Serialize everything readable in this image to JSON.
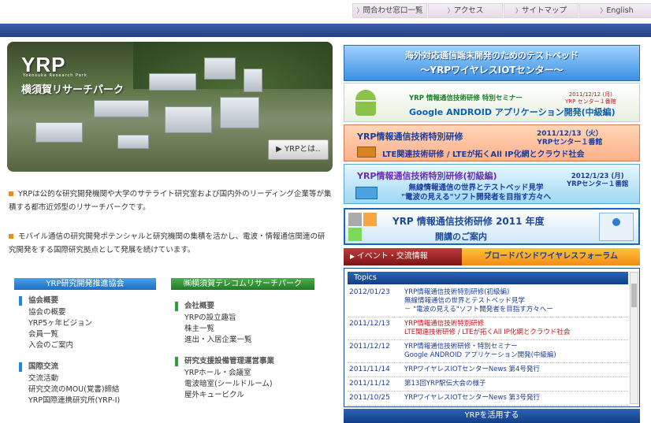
{
  "topnav": {
    "links": [
      "問合わせ窓口一覧",
      "アクセス",
      "サイトマップ",
      "English"
    ]
  },
  "hero": {
    "logo": "YRP",
    "logo_sub": "Yokosuka Research Park",
    "tagline": "横須賀リサーチパーク",
    "about_button": "▶ YRPとは‥"
  },
  "intro": {
    "p1": "YRPは公的な研究開発機関や大学のサテライト研究室および国内外のリーディング企業等が集積する都市近郊型のリサーチパークです。",
    "p2": "モバイル通信の研究開発ポテンシャルと研究機関の集積を活かし、電波・情報通信関連の研究開発をする国際研究拠点として発展を続けています。"
  },
  "left_section": {
    "header": "YRP研究開発推進協会",
    "groups": [
      {
        "heading": "協会概要",
        "items": [
          "協会の概要",
          "YRP5ヶ年ビジョン",
          "会員一覧",
          "入会のご案内"
        ]
      },
      {
        "heading": "国際交流",
        "items": [
          "交流活動",
          "研究交流のMOU(覚書)締結",
          "YRP国際連携研究所(YRP-I)"
        ]
      }
    ]
  },
  "right_section": {
    "header": "㈱横須賀テレコムリサーチパーク",
    "groups": [
      {
        "heading": "会社概要",
        "items": [
          "YRPの設立趣旨",
          "株主一覧",
          "進出・入居企業一覧"
        ]
      },
      {
        "heading": "研究支援設備管理運営事業",
        "items": [
          "YRPホール・会議室",
          "電波暗室(シールドルーム)",
          "屋外キュービクル"
        ]
      }
    ]
  },
  "banners": {
    "b1": {
      "line1": "海外対応通信端末開発のためのテストベッド",
      "line2": "〜YRPワイヤレスIOTセンター〜"
    },
    "b2": {
      "line1": "YRP 情報通信技術研修  特別セミナー",
      "line2": "Google ANDROID アプリケーション開発(中級編)",
      "date1": "2011/12/12 (月)",
      "date2": "YRP センター１番館"
    },
    "b3": {
      "line1": "YRP情報通信技術特別研修",
      "line2": "LTE関連技術研修 / LTEが拓くAll IP化網とクラウド社会",
      "date1": "2011/12/13（火）",
      "date2": "YRPセンター１番館"
    },
    "b4": {
      "line1": "YRP情報通信技術特別研修(初級編)",
      "line2a": "無線情報通信の世界とテストベッド見学",
      "line2b": "\"電波の見える\"ソフト開発者を目指す方々へ",
      "date1": "2012/1/23 (月)",
      "date2": "YRPセンター１番館"
    },
    "b5": {
      "line1": "YRP 情報通信技術研修 2011 年度",
      "line2": "開講のご案内"
    }
  },
  "tabs": {
    "events": "イベント・交流情報",
    "broadband": "ブロードバンドワイヤレスフォーラム"
  },
  "topics": {
    "header": "Topics",
    "rows": [
      {
        "date": "2012/01/23",
        "lines": [
          "YRP情報通信技術特別研修(初級編)",
          "無線情報通信の世界とテストベッド見学",
          "－ \"電波の見える\"ソフト開発者を目指す方々へー"
        ],
        "style": "a"
      },
      {
        "date": "2011/12/13",
        "lines": [
          "YRP情報通信技術特別研修",
          "LTE関連技術研修 / LTEが拓くAll IP化網とクラウド社会"
        ],
        "style": "r"
      },
      {
        "date": "2011/12/12",
        "lines": [
          "YRP情報通信技術研修・特別セミナー",
          "Google ANDROID アプリケーション開発(中級編)"
        ],
        "style": "a"
      },
      {
        "date": "2011/11/14",
        "lines": [
          "YRPワイヤレスIOTセンターNews 第4号発行"
        ],
        "style": "a"
      },
      {
        "date": "2011/11/12",
        "lines": [
          "第13回YRP駅伝大会の様子"
        ],
        "style": "a"
      },
      {
        "date": "2011/10/25",
        "lines": [
          "YRPワイヤレスIOTセンターNews 第3号発行"
        ],
        "style": "a"
      }
    ]
  },
  "use_bar": "YRPを活用する"
}
